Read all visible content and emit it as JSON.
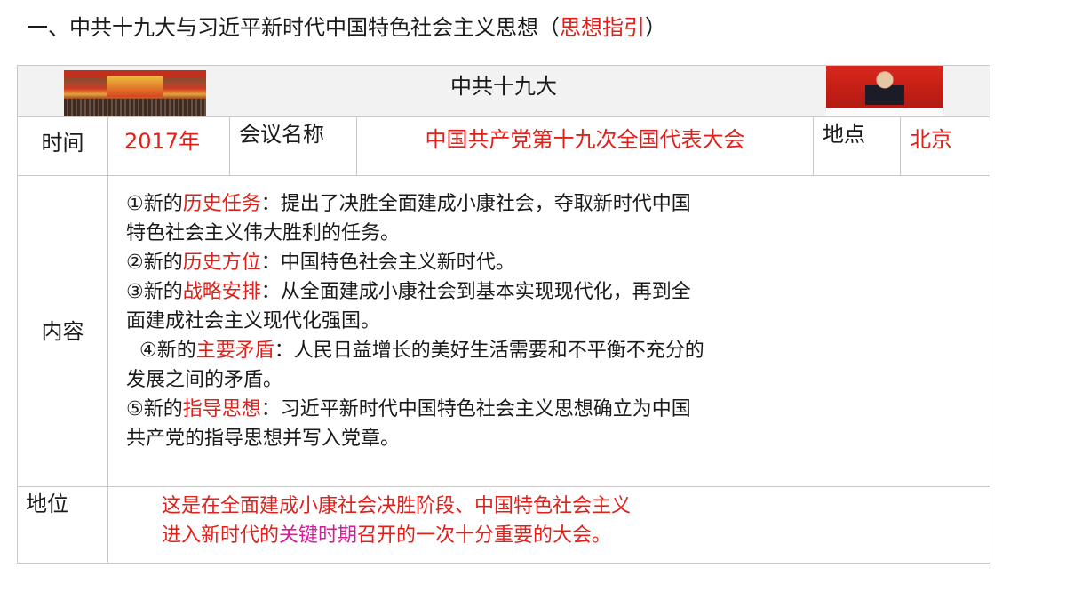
{
  "heading": {
    "prefix": "一、中共十九大与习近平新时代中国特色社会主义思想（",
    "highlight": "思想指引",
    "suffix": "）"
  },
  "table": {
    "header_title": "中共十九大",
    "time_label": "时间",
    "time_value": "2017年",
    "meeting_name_label": "会议名称",
    "meeting_name_value": "中国共产党第十九次全国代表大会",
    "place_label": "地点",
    "place_value": "北京",
    "content_label": "内容",
    "content_items": [
      {
        "prefix": "①新的",
        "key": "历史任务",
        "text": "：提出了决胜全面建成小康社会，夺取新时代中国",
        "text2": "特色社会主义伟大胜利的任务。"
      },
      {
        "prefix": "②新的",
        "key": "历史方位",
        "text": "：中国特色社会主义新时代。"
      },
      {
        "prefix": "③新的",
        "key": "战略安排",
        "text": "：从全面建成小康社会到基本实现现代化，再到全",
        "text2": "面建成社会主义现代化强国。"
      },
      {
        "prefix": "④新的",
        "key": "主要矛盾",
        "text": "：人民日益增长的美好生活需要和不平衡不充分的",
        "text2": "发展之间的矛盾。"
      },
      {
        "prefix": "⑤新的",
        "key": "指导思想",
        "text": "：习近平新时代中国特色社会主义思想确立为中国",
        "text2": "共产党的指导思想并写入党章。"
      }
    ],
    "position_label": "地位",
    "position_line1": "这是在全面建成小康社会决胜阶段、中国特色社会主义",
    "position_line2_a": "进入新时代的",
    "position_line2_b": "关键时期",
    "position_line2_c": "召开的一次十分重要的大会。"
  },
  "colors": {
    "accent_red": "#e0201a",
    "accent_magenta": "#d81b9a"
  }
}
